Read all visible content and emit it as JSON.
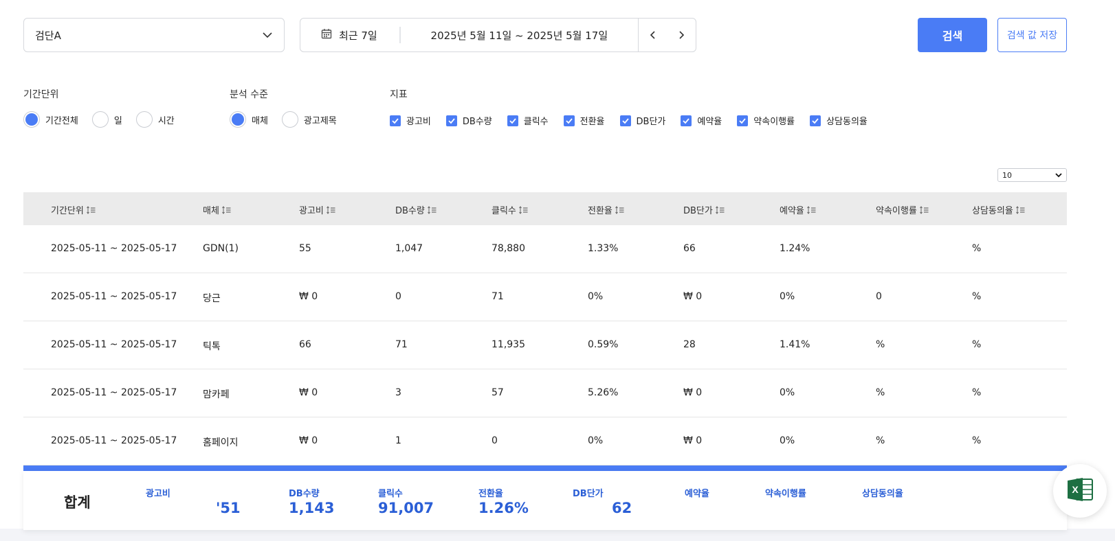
{
  "toolbar": {
    "group_select": "검단A",
    "date_preset": "최근 7일",
    "date_range": "2025년 5월 11일 ~ 2025년 5월 17일",
    "search_label": "검색",
    "save_label": "검색 값 저장"
  },
  "filters": {
    "period_label": "기간단위",
    "period_options": [
      "기간전체",
      "일",
      "시간"
    ],
    "level_label": "분석 수준",
    "level_options": [
      "매체",
      "광고제목"
    ],
    "metric_label": "지표",
    "metric_options": [
      "광고비",
      "DB수량",
      "클릭수",
      "전환율",
      "DB단가",
      "예약율",
      "약속이행률",
      "상담동의율"
    ]
  },
  "page_size": "10",
  "table": {
    "headers": [
      "기간단위",
      "매체",
      "광고비",
      "DB수량",
      "클릭수",
      "전환율",
      "DB단가",
      "예약율",
      "약속이행률",
      "상담동의율"
    ],
    "rows": [
      [
        "2025-05-11 ~ 2025-05-17",
        "GDN(1)",
        "55",
        "1,047",
        "78,880",
        "1.33%",
        "66",
        "1.24%",
        "",
        "%"
      ],
      [
        "2025-05-11 ~ 2025-05-17",
        "당근",
        "₩ 0",
        "0",
        "71",
        "0%",
        "₩ 0",
        "0%",
        "0",
        "%"
      ],
      [
        "2025-05-11 ~ 2025-05-17",
        "틱톡",
        "66",
        "71",
        "11,935",
        "0.59%",
        "28",
        "1.41%",
        "%",
        "%"
      ],
      [
        "2025-05-11 ~ 2025-05-17",
        "맘카페",
        "₩ 0",
        "3",
        "57",
        "5.26%",
        "₩ 0",
        "0%",
        "%",
        "%"
      ],
      [
        "2025-05-11 ~ 2025-05-17",
        "홈페이지",
        "₩ 0",
        "1",
        "0",
        "0%",
        "₩ 0",
        "0%",
        "%",
        "%"
      ]
    ]
  },
  "total": {
    "title": "합계",
    "labels": [
      "광고비",
      "DB수량",
      "클릭수",
      "전환율",
      "DB단가",
      "예약율",
      "약속이행률",
      "상담동의율"
    ],
    "values": [
      "'51",
      "1,143",
      "91,007",
      "1.26%",
      "62",
      "",
      "",
      ""
    ]
  },
  "colors": {
    "accent": "#4a7cf5",
    "total_text": "#2b5fd6",
    "excel_green": "#1d6f42"
  },
  "icons": [
    "chevron-down-icon",
    "calendar-icon",
    "chevron-left-icon",
    "chevron-right-icon",
    "check-icon",
    "sort-icon",
    "excel-icon"
  ]
}
